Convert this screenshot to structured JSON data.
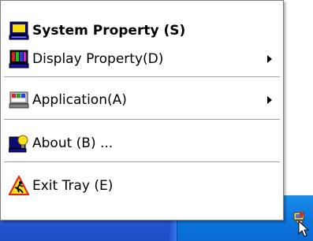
{
  "menu": {
    "items": [
      {
        "label": "System Property (S)",
        "icon": "monitor-icon",
        "bold": true
      },
      {
        "label": "Display Property(D)",
        "icon": "color-bars-icon",
        "submenu": true
      },
      {
        "label": "Application(A)",
        "icon": "application-icon",
        "submenu": true
      },
      {
        "label": "About (B) ...",
        "icon": "about-icon"
      },
      {
        "label": "Exit Tray (E)",
        "icon": "exit-icon"
      }
    ]
  },
  "tray": {
    "icon": "tray-app-icon"
  },
  "colors": {
    "taskbar": "#2457d2",
    "tray": "#0b77e0",
    "menu_background": "#ffffff",
    "separator": "#a0a0a0"
  }
}
